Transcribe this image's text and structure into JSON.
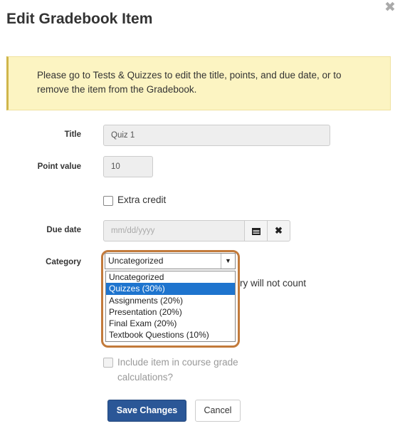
{
  "dialog": {
    "title": "Edit Gradebook Item",
    "close_glyph": "✖"
  },
  "notice": {
    "text": "Please go to Tests & Quizzes to edit the title, points, and due date, or to remove the item from the Gradebook."
  },
  "form": {
    "title_label": "Title",
    "title_value": "Quiz 1",
    "points_label": "Point value",
    "points_value": "10",
    "extra_credit_label": "Extra credit",
    "due_date_label": "Due date",
    "due_date_placeholder": "mm/dd/yyyy",
    "calendar_icon": "calendar-icon",
    "clear_icon": "clear-icon",
    "category_label": "Category",
    "category_selected": "Uncategorized",
    "category_options": [
      "Uncategorized",
      "Quizzes (30%)",
      "Assignments (20%)",
      "Presentation (20%)",
      "Final Exam (20%)",
      "Textbook Questions (10%)"
    ],
    "category_highlighted_index": 1,
    "category_note_partial": "ry will not count",
    "include_label": "Include item in course grade calculations?"
  },
  "actions": {
    "save_label": "Save Changes",
    "cancel_label": "Cancel"
  },
  "colors": {
    "primary": "#2b5797",
    "highlight": "#1e74ce",
    "annotation": "#c27a3b",
    "notice_bg": "#fcf4c2"
  }
}
